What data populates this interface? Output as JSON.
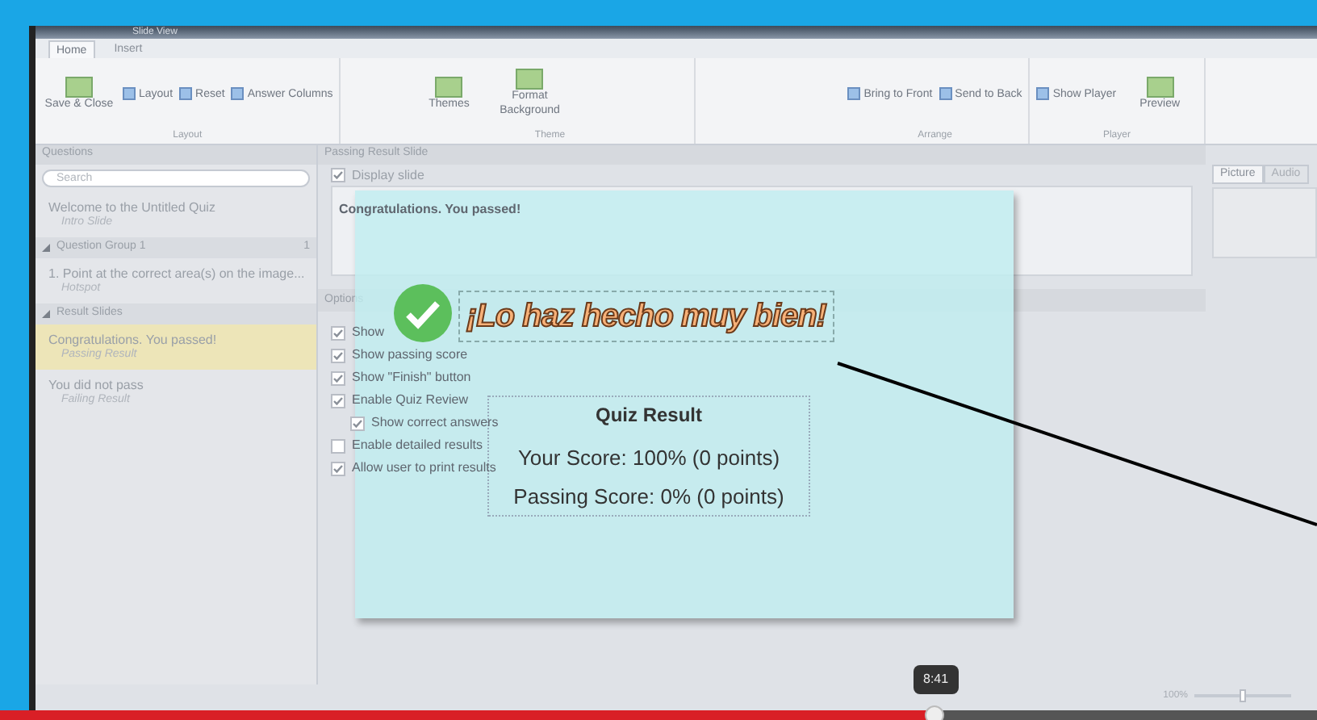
{
  "ribbon": {
    "title": "Slide View",
    "tabs": [
      {
        "label": "Home",
        "selected": true
      },
      {
        "label": "Insert",
        "selected": false
      }
    ],
    "groups": [
      {
        "label": "Layout",
        "buttons": [
          {
            "kind": "large",
            "label": "Save & Close"
          },
          {
            "kind": "small",
            "label": "Layout"
          },
          {
            "kind": "small",
            "label": "Reset"
          },
          {
            "kind": "small",
            "label": "Answer Columns"
          }
        ]
      },
      {
        "label": "Theme",
        "buttons": [
          {
            "kind": "large",
            "label": "Themes"
          },
          {
            "kind": "large",
            "label": "Format Background"
          }
        ]
      },
      {
        "label": "Arrange",
        "buttons": [
          {
            "kind": "small",
            "label": "Bring to Front"
          },
          {
            "kind": "small",
            "label": "Send to Back"
          }
        ]
      },
      {
        "label": "Player",
        "buttons": [
          {
            "kind": "small",
            "label": "Show Player"
          },
          {
            "kind": "large",
            "label": "Preview"
          }
        ]
      }
    ]
  },
  "questions_panel": {
    "title": "Questions",
    "search": {
      "placeholder": "Search"
    },
    "items": [
      {
        "kind": "slide",
        "title": "Welcome to the Untitled Quiz",
        "subtitle": "Intro Slide",
        "selected": false
      },
      {
        "kind": "group",
        "title": "Question Group 1",
        "count": "1",
        "expanded": true
      },
      {
        "kind": "slide",
        "title": "1. Point at the correct area(s) on the image...",
        "subtitle": "Hotspot",
        "selected": false
      },
      {
        "kind": "group",
        "title": "Result Slides",
        "expanded": true
      },
      {
        "kind": "slide",
        "title": "Congratulations. You passed!",
        "subtitle": "Passing Result",
        "selected": true
      },
      {
        "kind": "slide",
        "title": "You did not pass",
        "subtitle": "Failing Result",
        "selected": false
      }
    ]
  },
  "editor": {
    "title": "Passing Result Slide",
    "display_slide": {
      "label": "Display slide",
      "checked": true
    },
    "message": "Congratulations. You passed!",
    "options_title": "Options",
    "options": [
      {
        "label": "Show",
        "checked": true
      },
      {
        "label": "Show passing score",
        "checked": true
      },
      {
        "label": "Show \"Finish\" button",
        "checked": true
      },
      {
        "label": "Enable Quiz Review",
        "checked": true,
        "children": [
          {
            "label": "Show correct answers",
            "checked": true
          }
        ]
      },
      {
        "label": "Enable detailed results",
        "checked": false
      },
      {
        "label": "Allow user to print results",
        "checked": true
      }
    ]
  },
  "side_panel": {
    "tabs": [
      {
        "label": "Picture",
        "selected": true
      },
      {
        "label": "Audio",
        "selected": false
      }
    ]
  },
  "slide_preview": {
    "heading": "¡Lo haz hecho muy bien!",
    "result_title": "Quiz Result",
    "score": "Your Score: 100% (0 points)",
    "passing": "Passing Score: 0% (0 points)"
  },
  "zoom": {
    "label": "100%",
    "level": 0.5
  },
  "player": {
    "time": "8:41",
    "level": 0.71
  }
}
